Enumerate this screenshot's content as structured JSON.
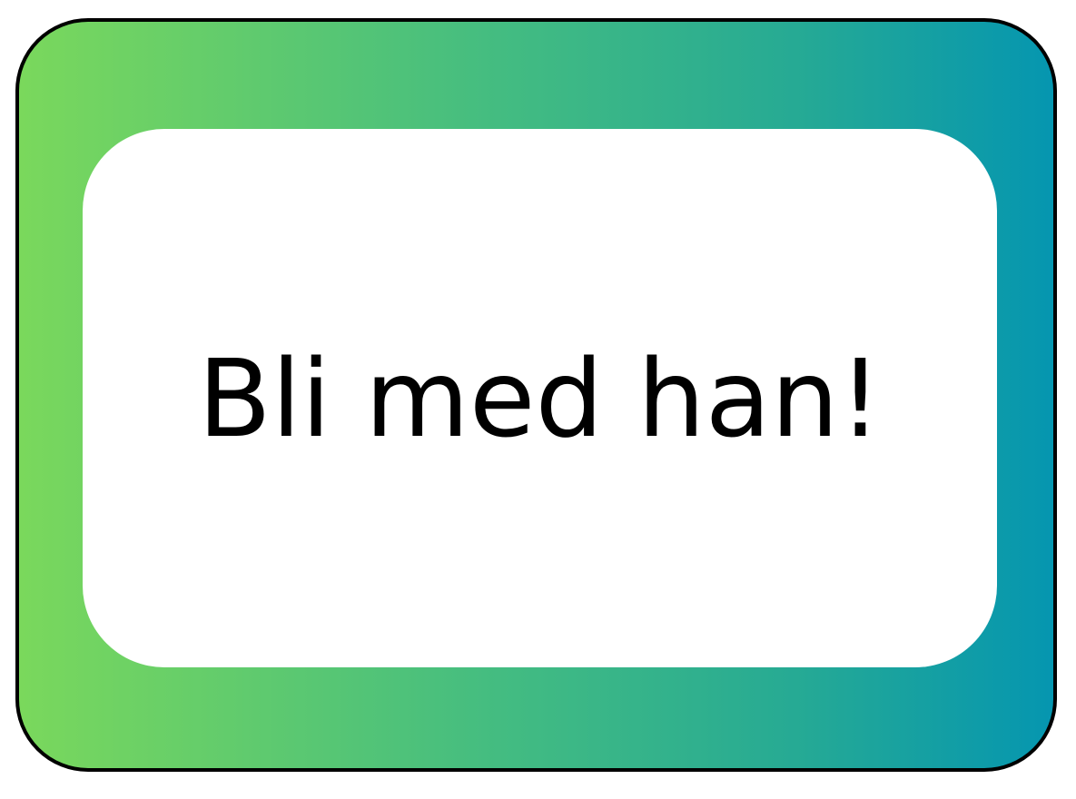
{
  "card": {
    "message": "Bli med han!",
    "gradient_colors": [
      "#7ad85c",
      "#45bd80",
      "#26aa94",
      "#0596b0"
    ],
    "border_color": "#000000",
    "inner_color": "#ffffff"
  }
}
